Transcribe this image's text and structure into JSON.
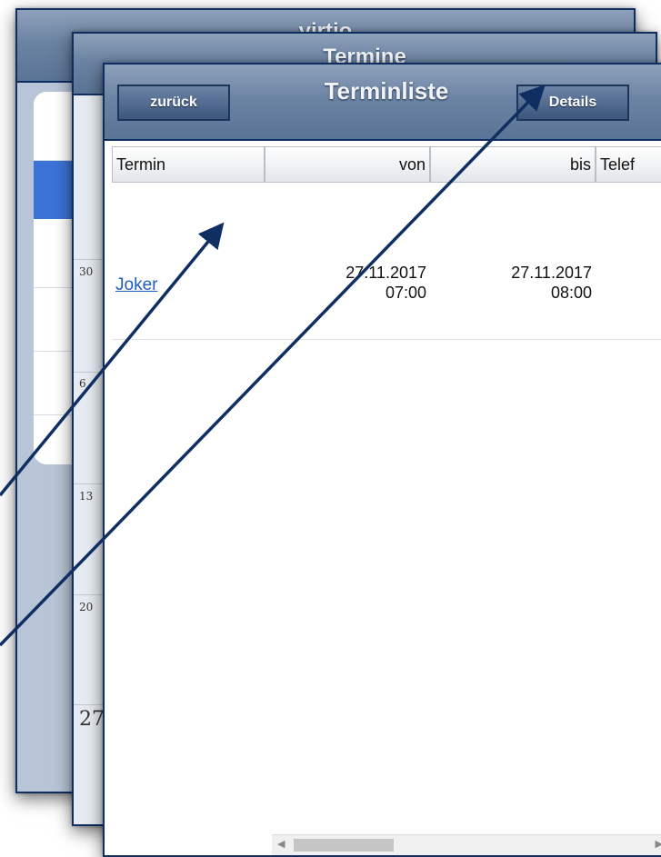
{
  "back_panel": {
    "title": "virtio"
  },
  "middle_panel": {
    "title": "Termine",
    "calendar_days": [
      "30",
      "6",
      "13",
      "20",
      "27"
    ]
  },
  "front_panel": {
    "title": "Terminliste",
    "back_button": "zurück",
    "details_button": "Details",
    "columns": [
      "Termin",
      "von",
      "bis",
      "Telef"
    ],
    "rows": [
      {
        "termin": "Joker",
        "von_date": "27.11.2017",
        "von_time": "07:00",
        "bis_date": "27.11.2017",
        "bis_time": "08:00"
      }
    ]
  },
  "colors": {
    "header": "#6c84a3",
    "border": "#0f2f63",
    "link": "#1f5fbf",
    "selected_row": "#3c73d6"
  },
  "icons": {
    "scroll_left": "chevron-left-icon",
    "scroll_right": "chevron-right-icon"
  }
}
